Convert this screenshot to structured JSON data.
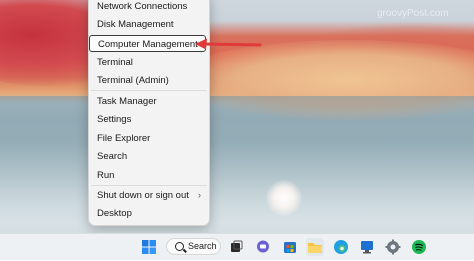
{
  "watermark": "groovyPost.com",
  "context_menu": {
    "items": [
      {
        "label": "Network Connections"
      },
      {
        "label": "Disk Management"
      },
      {
        "label": "Computer Management"
      },
      {
        "label": "Terminal"
      },
      {
        "label": "Terminal (Admin)"
      },
      {
        "label": "Task Manager"
      },
      {
        "label": "Settings"
      },
      {
        "label": "File Explorer"
      },
      {
        "label": "Search"
      },
      {
        "label": "Run"
      },
      {
        "label": "Shut down or sign out"
      },
      {
        "label": "Desktop"
      }
    ],
    "highlighted": "Computer Management",
    "submenu_chevron": "›"
  },
  "taskbar": {
    "search_label": "Search",
    "icons": [
      "start-icon",
      "task-view-icon",
      "teams-chat-icon",
      "store-icon",
      "file-explorer-icon",
      "edge-icon",
      "desktop-app-icon",
      "settings-icon",
      "spotify-icon"
    ]
  },
  "colors": {
    "arrow": "#e03a3a",
    "menu_bg": "#f3f3f3",
    "taskbar_bg": "#eef1f3"
  }
}
